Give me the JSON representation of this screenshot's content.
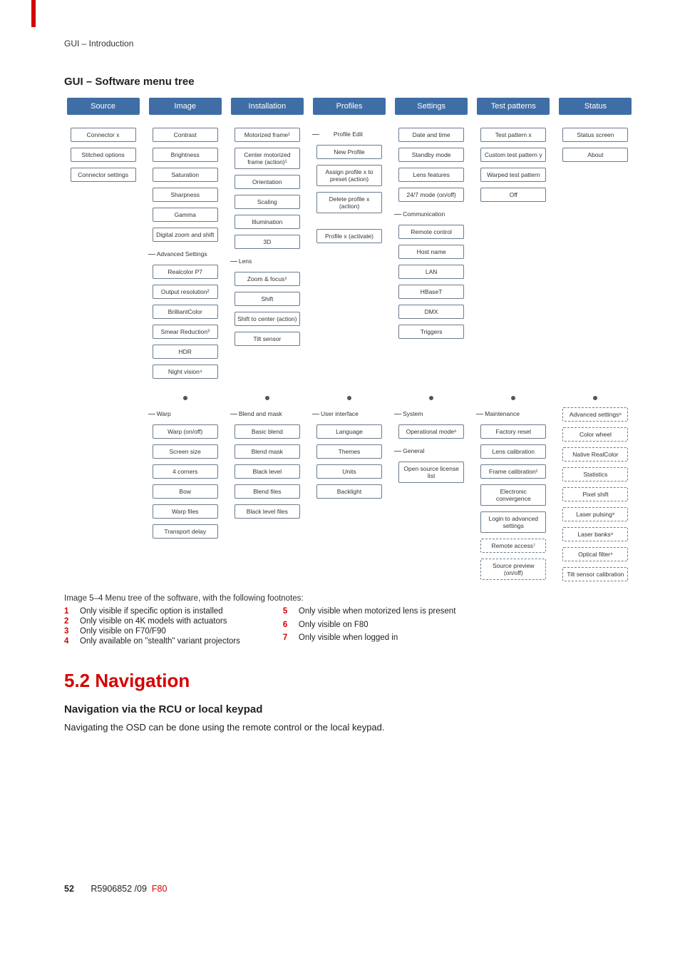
{
  "header": {
    "running_head": "GUI – Introduction"
  },
  "section_title": "GUI – Software menu tree",
  "tree": {
    "top": [
      "Source",
      "Image",
      "Installation",
      "Profiles",
      "Settings",
      "Test patterns",
      "Status"
    ],
    "cols": {
      "source": [
        "Connector x",
        "Stitched options",
        "Connector settings"
      ],
      "image": {
        "main": [
          "Contrast",
          "Brightness",
          "Saturation",
          "Sharpness",
          "Gamma",
          "Digital zoom and shift"
        ],
        "adv_label": "Advanced Settings",
        "adv": [
          "Realcolor P7",
          "Output resolution²",
          "BrilliantColor",
          "Smear Reduction³",
          "HDR",
          "Night vision⁴"
        ],
        "lower_label": "Warp",
        "lower": [
          "Warp (on/off)",
          "Screen size",
          "4 corners",
          "Bow",
          "Warp files",
          "Transport delay"
        ]
      },
      "installation": {
        "main": [
          "Motorized frame¹",
          "Center motorized frame (action)¹",
          "Orientation",
          "Scaling",
          "Illumination",
          "3D"
        ],
        "lens_label": "Lens",
        "lens": [
          "Zoom & focus⁵",
          "Shift",
          "Shift to center (action)",
          "Tilt sensor"
        ],
        "lower_label": "Blend and mask",
        "lower": [
          "Basic blend",
          "Blend mask",
          "Black level",
          "Blend files",
          "Black level files"
        ]
      },
      "profiles": {
        "edit_label": "Profile Edit",
        "edit": [
          "New Profile",
          "Assign profile x to preset (action)",
          "Delete profile x (action)"
        ],
        "activate": "Profile x (activate)",
        "lower_label": "User interface",
        "lower": [
          "Language",
          "Themes",
          "Units",
          "Backlight"
        ]
      },
      "settings": {
        "main": [
          "Date and time",
          "Standby mode",
          "Lens features",
          "24/7 mode (on/off)"
        ],
        "comm_label": "Communication",
        "comm": [
          "Remote control",
          "Host name",
          "LAN",
          "HBaseT",
          "DMX",
          "Triggers"
        ],
        "lower_sys_label": "System",
        "lower_sys": [
          "Operational mode⁶"
        ],
        "lower_gen_label": "General",
        "lower_gen": [
          "Open source license list"
        ]
      },
      "testpatterns": {
        "main": [
          "Test pattern x",
          "Custom test pattern y",
          "Warped test pattern",
          "Off"
        ],
        "lower_label": "Maintenance",
        "lower": [
          "Factory reset",
          "Lens calibration",
          "Frame calibration¹",
          "Electronic convergence",
          "Login to advanced settings"
        ],
        "lower_dashed": [
          "Remote access⁷",
          "Source preview (on/off)"
        ]
      },
      "status": {
        "main": [
          "Status screen",
          "About"
        ],
        "lower_label": "Advanced settings⁸",
        "lower_dashed": [
          "Color wheel",
          "Native RealColor",
          "Statistics",
          "Pixel shift",
          "Laser pulsing⁹",
          "Laser banks⁸",
          "Optical filter⁹",
          "Tilt sensor calibration"
        ]
      }
    }
  },
  "caption": "Image 5–4   Menu tree of the software, with the following footnotes:",
  "footnotes": {
    "left": [
      {
        "n": "1",
        "t": "Only visible if specific option is installed"
      },
      {
        "n": "2",
        "t": "Only visible on 4K models with actuators"
      },
      {
        "n": "3",
        "t": "Only visible on F70/F90"
      },
      {
        "n": "4",
        "t": "Only available on \"stealth\" variant projectors"
      }
    ],
    "right": [
      {
        "n": "5",
        "t": "Only visible when motorized lens is present"
      },
      {
        "n": "6",
        "t": "Only visible on F80"
      },
      {
        "n": "7",
        "t": "Only visible when logged in"
      }
    ]
  },
  "nav": {
    "h1": "5.2 Navigation",
    "h3": "Navigation via the RCU or local keypad",
    "para": "Navigating the OSD can be done using the remote control or the local keypad."
  },
  "footer": {
    "page": "52",
    "doc": "R5906852 /09",
    "model": "F80"
  }
}
